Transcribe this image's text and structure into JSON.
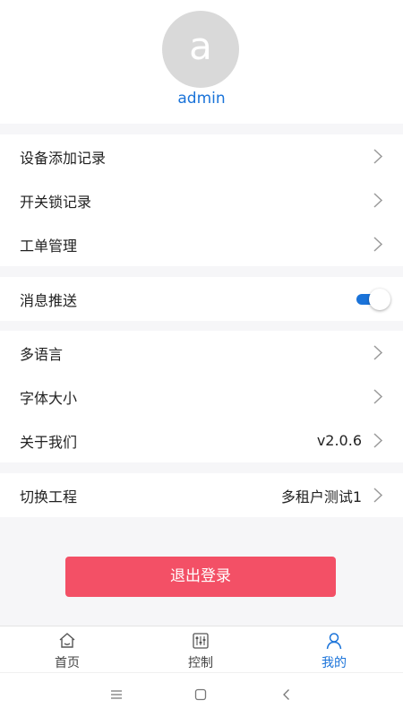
{
  "profile": {
    "avatar_letter": "a",
    "username": "admin"
  },
  "group1": [
    {
      "label": "设备添加记录"
    },
    {
      "label": "开关锁记录"
    },
    {
      "label": "工单管理"
    }
  ],
  "group2": {
    "push": {
      "label": "消息推送",
      "enabled": true
    }
  },
  "group3": [
    {
      "label": "多语言"
    },
    {
      "label": "字体大小"
    },
    {
      "label": "关于我们",
      "value": "v2.0.6"
    }
  ],
  "group4": {
    "label": "切换工程",
    "value": "多租户测试1"
  },
  "logout": {
    "label": "退出登录"
  },
  "tabbar": [
    {
      "label": "首页",
      "icon": "home-icon",
      "active": false
    },
    {
      "label": "控制",
      "icon": "control-icon",
      "active": false
    },
    {
      "label": "我的",
      "icon": "person-icon",
      "active": true
    }
  ],
  "system_nav": [
    "menu-icon",
    "square-icon",
    "back-icon"
  ],
  "colors": {
    "accent": "#1a73d9",
    "logout_button": "#f35066",
    "page_background": "#f6f6f8",
    "avatar": "#d9d9d9"
  }
}
